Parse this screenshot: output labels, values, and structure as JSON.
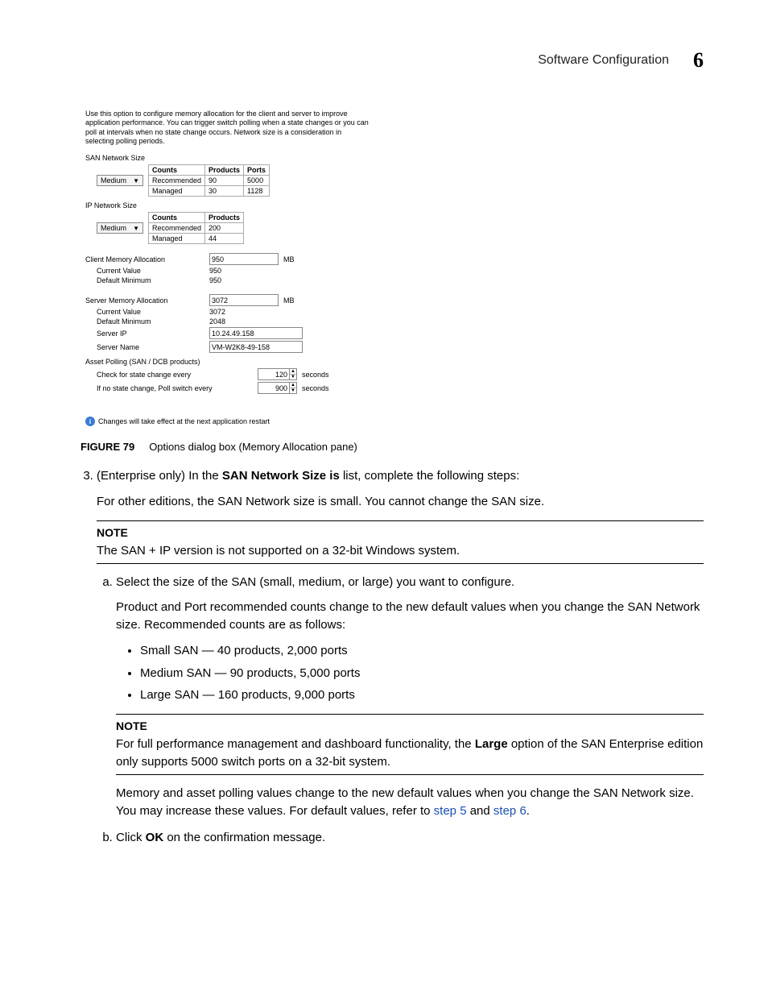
{
  "header": {
    "title": "Software Configuration",
    "chapter": "6"
  },
  "figure": {
    "intro": "Use this option to configure memory allocation for the client and server to improve application performance. You can trigger switch polling when a state changes or you can poll at intervals when no state change occurs. Network size is a consideration in selecting polling periods.",
    "san_label": "SAN Network Size",
    "ip_label": "IP Network Size",
    "dd_value": "Medium",
    "san_table": {
      "headers": [
        "Counts",
        "Products",
        "Ports"
      ],
      "rows": [
        [
          "Recommended",
          "90",
          "5000"
        ],
        [
          "Managed",
          "30",
          "1128"
        ]
      ]
    },
    "ip_table": {
      "headers": [
        "Counts",
        "Products"
      ],
      "rows": [
        [
          "Recommended",
          "200"
        ],
        [
          "Managed",
          "44"
        ]
      ]
    },
    "client_alloc": {
      "label": "Client Memory Allocation",
      "value": "950",
      "unit": "MB",
      "current_label": "Current Value",
      "current": "950",
      "min_label": "Default Minimum",
      "min": "950"
    },
    "server_alloc": {
      "label": "Server Memory Allocation",
      "value": "3072",
      "unit": "MB",
      "current_label": "Current Value",
      "current": "3072",
      "min_label": "Default Minimum",
      "min": "2048",
      "ip_label": "Server IP",
      "ip": "10.24.49.158",
      "name_label": "Server Name",
      "name": "VM-W2K8-49-158"
    },
    "polling": {
      "label": "Asset Polling (SAN / DCB products)",
      "l1": "Check for state change every",
      "v1": "120",
      "l2": "If no state change, Poll switch every",
      "v2": "900",
      "unit": "seconds"
    },
    "restart": "Changes will take effect at the next application restart"
  },
  "figcap": {
    "num": "FIGURE 79",
    "text": "Options dialog box (Memory Allocation pane)"
  },
  "step3": {
    "num": "3.",
    "lead_a": "(Enterprise only) In the ",
    "lead_b": "SAN Network Size is",
    "lead_c": " list, complete the following steps:",
    "para1": "For other editions, the SAN Network size is small. You cannot change the SAN size.",
    "note1": {
      "title": "NOTE",
      "body": "The SAN + IP version is not supported on a 32-bit Windows system."
    },
    "a_text": "Select the size of the SAN (small, medium, or large) you want to configure.",
    "a_para": "Product and Port recommended counts change to the new default values when you change the SAN Network size. Recommended counts are as follows:",
    "bul": [
      "Small SAN — 40 products, 2,000 ports",
      "Medium SAN — 90 products, 5,000 ports",
      "Large SAN — 160 products, 9,000 ports"
    ],
    "note2": {
      "title": "NOTE",
      "body_a": "For full performance management and dashboard functionality, the ",
      "body_b": "Large",
      "body_c": " option of the SAN Enterprise edition only supports 5000 switch ports on a 32-bit system."
    },
    "para2_a": "Memory and asset polling values change to the new default values when you change the SAN Network size. You may increase these values. For default values, refer to ",
    "link1": "step 5",
    "para2_b": " and ",
    "link2": "step 6",
    "para2_c": ".",
    "b_a": "Click ",
    "b_b": "OK",
    "b_c": " on the confirmation message."
  }
}
